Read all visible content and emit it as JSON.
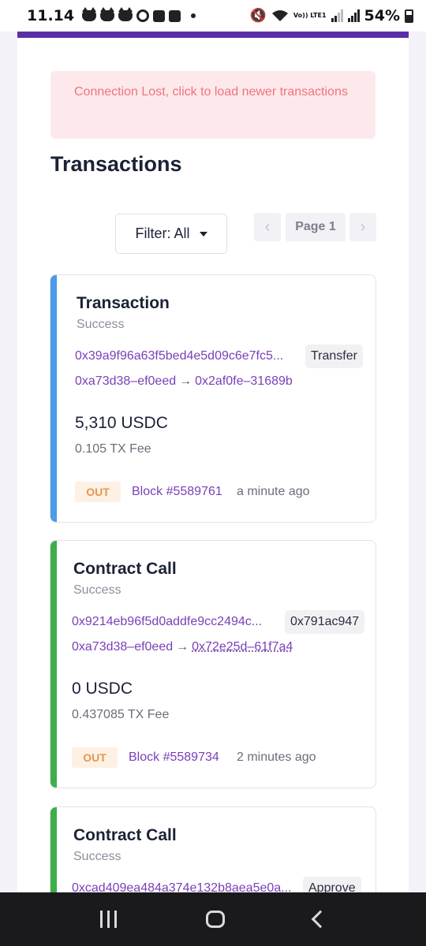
{
  "status_bar": {
    "time": "11.14",
    "network": "Vo)) LTE1",
    "battery": "54%"
  },
  "alert": {
    "text": "Connection Lost, click to load newer transactions"
  },
  "title": "Transactions",
  "filter": {
    "label": "Filter: All"
  },
  "pagination": {
    "prev": "‹",
    "label": "Page 1",
    "next": "›"
  },
  "transactions": [
    {
      "type": "Transaction",
      "status": "Success",
      "hash": "0x39a9f96a63f5bed4e5d09c6e7fc5...",
      "method": "Transfer",
      "from": "0xa73d38–ef0eed",
      "arrow": "→",
      "to": "0x2af0fe–31689b",
      "amount": "5,310 USDC",
      "fee": "0.105 TX Fee",
      "direction": "OUT",
      "block": "Block #5589761",
      "time": "a minute ago",
      "accent_color": "#4a9be8"
    },
    {
      "type": "Contract Call",
      "status": "Success",
      "hash": "0x9214eb96f5d0addfe9cc2494c...",
      "method": "0x791ac947",
      "from": "0xa73d38–ef0eed",
      "arrow": "→",
      "to": "0x72e25d–61f7a4",
      "amount": "0 USDC",
      "fee": "0.437085 TX Fee",
      "direction": "OUT",
      "block": "Block #5589734",
      "time": "2 minutes ago",
      "accent_color": "#3fae4a"
    },
    {
      "type": "Contract Call",
      "status": "Success",
      "hash": "0xcad409ea484a374e132b8aea5e0a...",
      "method": "Approve",
      "accent_color": "#3fae4a"
    }
  ],
  "colors": {
    "brand": "#5b2ea6",
    "link": "#7a3fb8",
    "alert_bg": "#fde9ec",
    "alert_text": "#f0737a",
    "out_badge_bg": "#fdf1e4",
    "out_badge_text": "#e7954e"
  }
}
